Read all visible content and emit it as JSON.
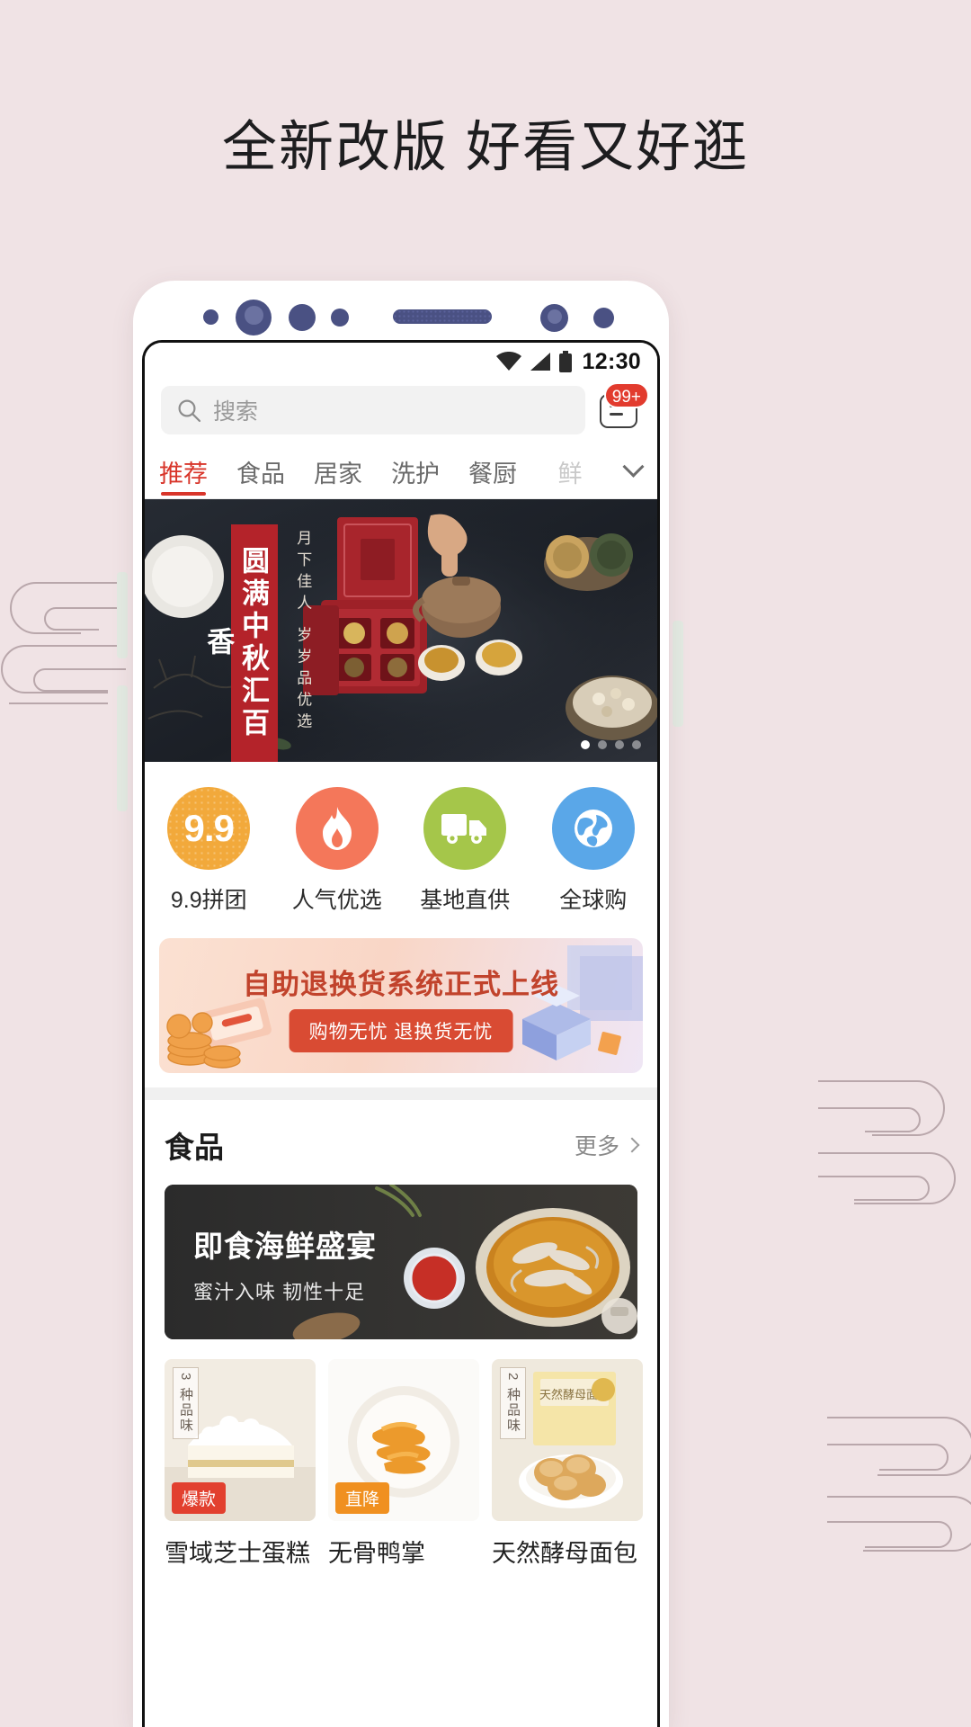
{
  "headline": "全新改版 好看又好逛",
  "status": {
    "time": "12:30",
    "wifi_icon": "wifi-icon",
    "signal_icon": "signal-icon",
    "battery_icon": "battery-icon"
  },
  "search": {
    "placeholder": "搜索",
    "icon": "search-icon"
  },
  "message": {
    "icon": "message-icon",
    "badge": "99+"
  },
  "tabs": [
    {
      "label": "推荐",
      "active": true
    },
    {
      "label": "食品",
      "active": false
    },
    {
      "label": "居家",
      "active": false
    },
    {
      "label": "洗护",
      "active": false
    },
    {
      "label": "餐厨",
      "active": false
    },
    {
      "label": "鲜",
      "active": false
    }
  ],
  "tabs_expand_icon": "chevron-down-icon",
  "hero": {
    "title": "圆满中秋汇百香",
    "subtitle": "月下佳人 岁岁品优选",
    "dots_total": 4,
    "dots_active": 1
  },
  "quick_actions": [
    {
      "label": "9.9拼团",
      "icon": "nine-nine-icon",
      "badge_text": "9.9",
      "color": "#f2a93b"
    },
    {
      "label": "人气优选",
      "icon": "flame-icon",
      "color": "#f4775a"
    },
    {
      "label": "基地直供",
      "icon": "truck-icon",
      "color": "#a5c64a"
    },
    {
      "label": "全球购",
      "icon": "globe-icon",
      "color": "#5aa7e8"
    }
  ],
  "promo": {
    "title": "自助退换货系统正式上线",
    "pill": "购物无忧  退换货无忧",
    "coins_icon": "coins-icon",
    "box_icon": "open-box-icon"
  },
  "section": {
    "title": "食品",
    "more_label": "更多",
    "more_icon": "chevron-right-icon"
  },
  "feature": {
    "title": "即食海鲜盛宴",
    "subtitle": "蜜汁入味 韧性十足"
  },
  "products": [
    {
      "name": "雪域芝士蛋糕",
      "tag": "爆款",
      "tag_color": "#e2402f",
      "corner_label": "3 种品味"
    },
    {
      "name": "无骨鸭掌",
      "tag": "直降",
      "tag_color": "#f09020",
      "corner_label": ""
    },
    {
      "name": "天然酵母面包",
      "tag": "",
      "tag_color": "",
      "corner_label": "2 种品味"
    }
  ],
  "colors": {
    "page_bg": "#f0e3e5",
    "accent_red": "#d8352a",
    "bezel_blue": "#4a5183",
    "promo_red": "#d94b33"
  }
}
